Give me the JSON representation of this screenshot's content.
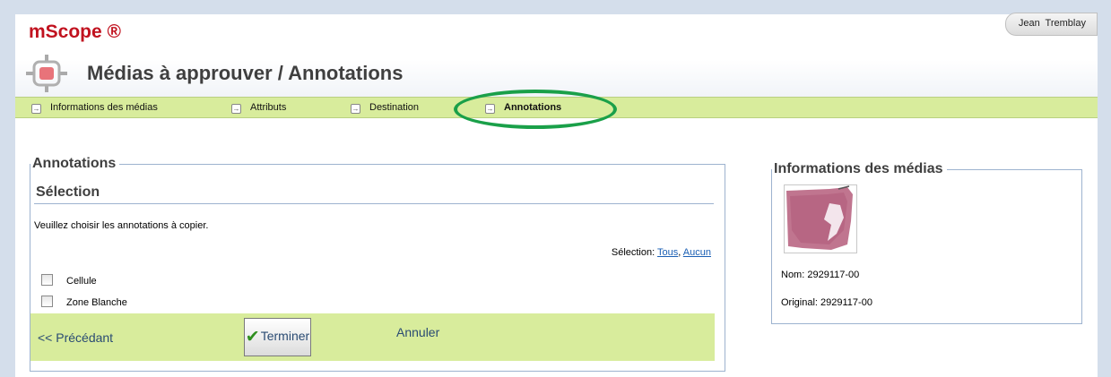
{
  "header": {
    "brand": "mScope ®",
    "user": "Jean Tremblay",
    "page_title": "Médias à approuver / Annotations",
    "logo_icon": "crosshair-target-icon"
  },
  "nav": {
    "items": [
      {
        "label": "Informations des médias",
        "active": false
      },
      {
        "label": "Attributs",
        "active": false
      },
      {
        "label": "Destination",
        "active": false
      },
      {
        "label": "Annotations",
        "active": true
      }
    ],
    "item_icon": "right-arrow-box-icon",
    "highlight_color": "#1aa049"
  },
  "annotations": {
    "legend": "Annotations",
    "section_title": "Sélection",
    "instructions": "Veuillez choisir les annotations à copier.",
    "selection_label": "Sélection:",
    "select_all": "Tous",
    "separator": ",",
    "select_none": "Aucun",
    "checkboxes": [
      {
        "label": "Cellule",
        "checked": false
      },
      {
        "label": "Zone Blanche",
        "checked": false
      }
    ]
  },
  "actions": {
    "previous": "<< Précédant",
    "finish": "Terminer",
    "cancel": "Annuler"
  },
  "media_info": {
    "legend": "Informations des médias",
    "thumbnail_icon": "tissue-slide-thumbnail",
    "name_label": "Nom:",
    "name_value": "2929117-00",
    "original_label": "Original:",
    "original_value": "2929117-00"
  },
  "colors": {
    "brand": "#c1121f",
    "nav_bar": "#d8ec9c",
    "panel_border": "#9db3cf",
    "link": "#1a5fb4"
  }
}
